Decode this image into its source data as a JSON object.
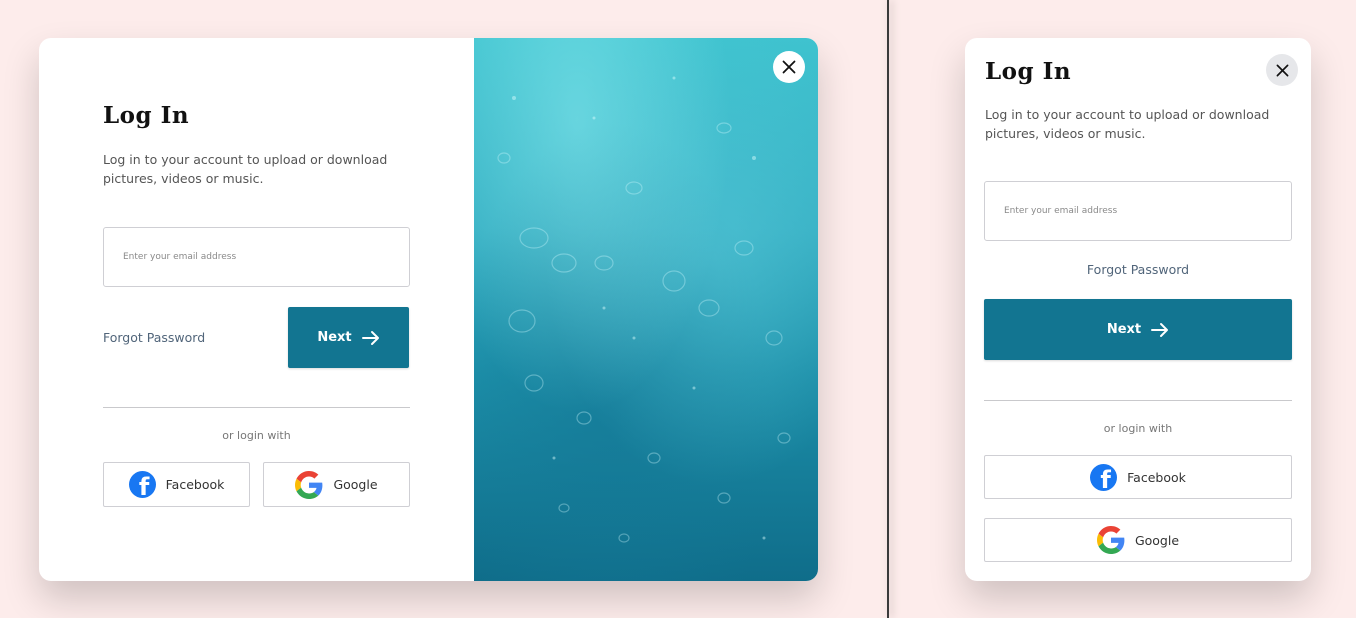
{
  "desktop": {
    "title": "Log In",
    "subtitle": "Log in to your account to upload or download pictures, videos or music.",
    "email_placeholder": "Enter your email address",
    "forgot_label": "Forgot Password",
    "next_label": "Next",
    "or_label": "or login with",
    "facebook_label": "Facebook",
    "google_label": "Google"
  },
  "mobile": {
    "title": "Log In",
    "subtitle": "Log in to your account to upload or download pictures, videos or music.",
    "email_placeholder": "Enter your email address",
    "forgot_label": "Forgot Password",
    "next_label": "Next",
    "or_label": "or login with",
    "facebook_label": "Facebook",
    "google_label": "Google"
  },
  "colors": {
    "background": "#fdeceb",
    "primary_button": "#127591",
    "facebook_blue": "#1877f2"
  }
}
